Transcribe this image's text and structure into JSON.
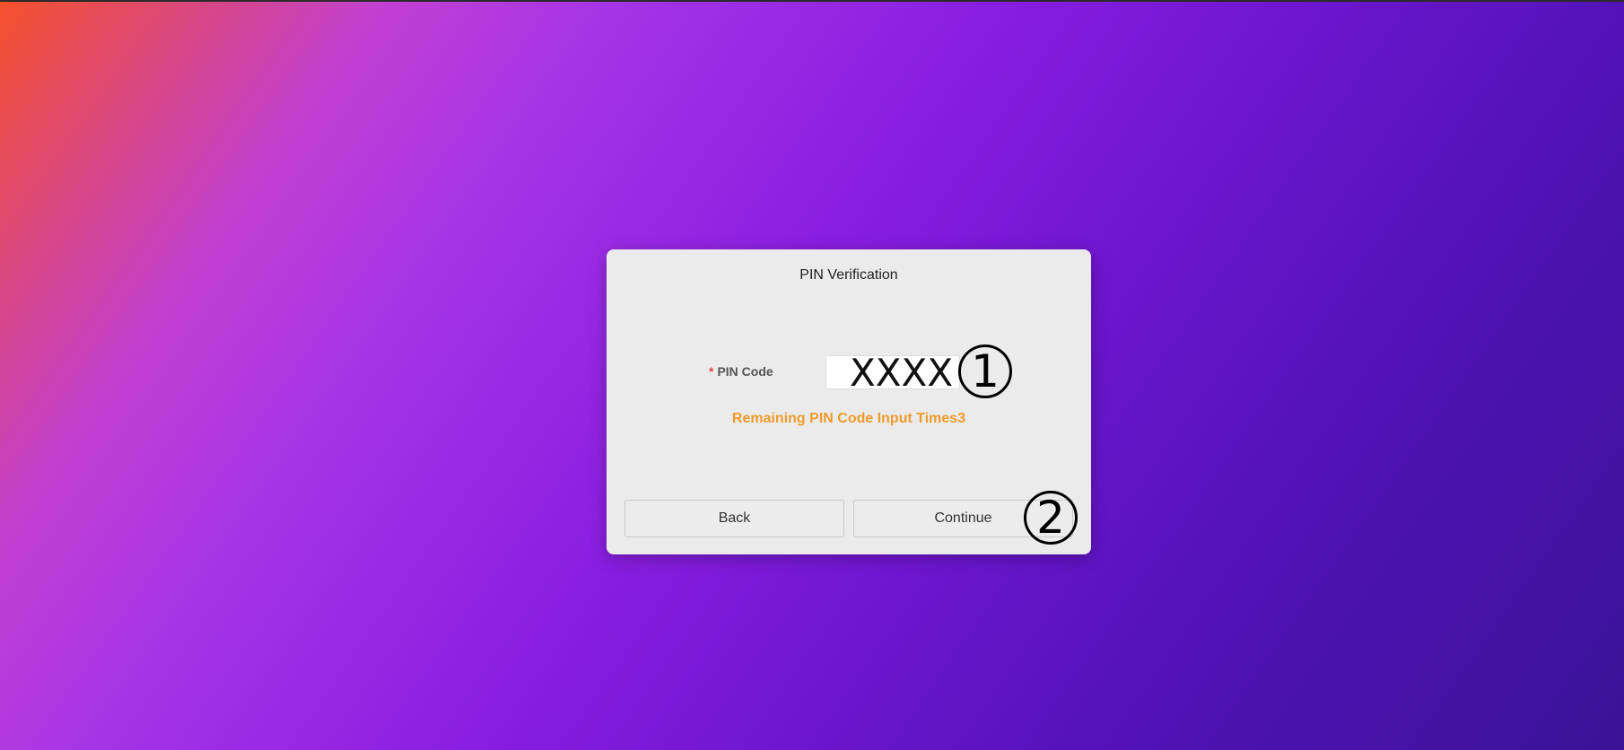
{
  "dialog": {
    "title": "PIN Verification",
    "pin_field": {
      "required_mark": "*",
      "label": "PIN Code",
      "value": "XXXX"
    },
    "remaining_message": "Remaining PIN Code Input Times3",
    "buttons": {
      "back_label": "Back",
      "continue_label": "Continue"
    }
  },
  "markers": {
    "first": "1",
    "second": "2"
  },
  "colors": {
    "dialog_background": "#ebebeb",
    "warning_text": "#ee9b2c",
    "required_mark": "#e34a4a"
  }
}
